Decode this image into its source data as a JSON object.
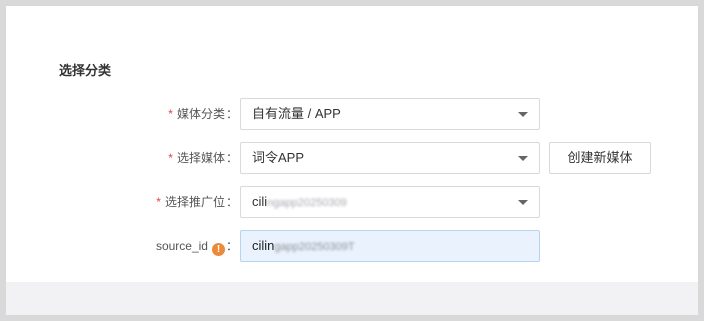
{
  "section": {
    "title": "选择分类"
  },
  "form": {
    "media_category": {
      "label": "媒体分类",
      "required": "*",
      "value": "自有流量 / APP"
    },
    "select_media": {
      "label": "选择媒体",
      "required": "*",
      "value": "词令APP",
      "create_button": "创建新媒体"
    },
    "promotion_slot": {
      "label": "选择推广位",
      "required": "*",
      "value_prefix": "cili",
      "value_obscured": "ngapp20250309"
    },
    "source_id": {
      "label": "source_id",
      "info_icon": "!",
      "value_prefix": "cilin",
      "value_obscured": "gapp20250309T"
    },
    "colon": "："
  },
  "colors": {
    "required": "#e04444",
    "warning": "#ec8a3b",
    "input_highlight": "#eaf3fd"
  }
}
